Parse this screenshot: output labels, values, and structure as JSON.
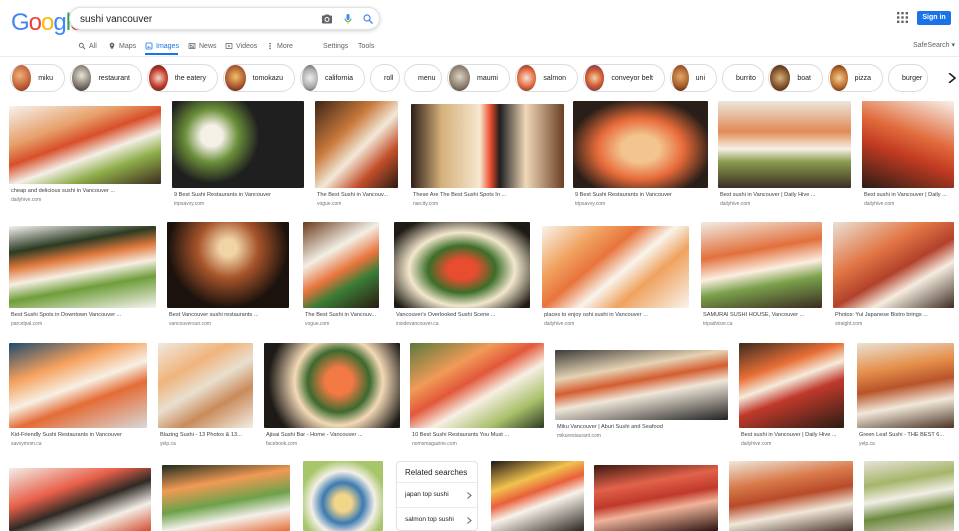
{
  "logo": "Google",
  "colors": {
    "accent": "#1a73e8",
    "g_blue": "#4285f4",
    "g_red": "#ea4335",
    "g_yellow": "#fbbc05",
    "g_green": "#34a853"
  },
  "search": {
    "query": "sushi vancouver",
    "icons": [
      "camera-icon",
      "microphone-icon",
      "search-icon"
    ]
  },
  "header": {
    "apps_icon": "apps-grid-icon",
    "signin_label": "Sign in"
  },
  "tabs": [
    {
      "label": "All",
      "icon": "search-icon",
      "active": false
    },
    {
      "label": "Maps",
      "icon": "map-pin-icon",
      "active": false
    },
    {
      "label": "Images",
      "icon": "image-icon",
      "active": true
    },
    {
      "label": "News",
      "icon": "news-icon",
      "active": false
    },
    {
      "label": "Videos",
      "icon": "play-icon",
      "active": false
    },
    {
      "label": "More",
      "icon": "more-vert-icon",
      "active": false
    }
  ],
  "tools": {
    "settings": "Settings",
    "tools": "Tools",
    "safesearch": "SafeSearch ▾"
  },
  "chips": [
    {
      "label": "miku",
      "thumb": true
    },
    {
      "label": "restaurant",
      "thumb": true
    },
    {
      "label": "the eatery",
      "thumb": true
    },
    {
      "label": "tomokazu",
      "thumb": true
    },
    {
      "label": "california",
      "thumb": true
    },
    {
      "label": "roll",
      "thumb": false
    },
    {
      "label": "menu",
      "thumb": false
    },
    {
      "label": "maumi",
      "thumb": true
    },
    {
      "label": "salmon",
      "thumb": true
    },
    {
      "label": "conveyor belt",
      "thumb": true
    },
    {
      "label": "uni",
      "thumb": true
    },
    {
      "label": "burrito",
      "thumb": false
    },
    {
      "label": "boat",
      "thumb": true
    },
    {
      "label": "pizza",
      "thumb": true
    },
    {
      "label": "burger",
      "thumb": false
    }
  ],
  "results": [
    {
      "caption": "cheap and delicious sushi in Vancouver ...",
      "domain": "dailyhive.com"
    },
    {
      "caption": "9 Best Sushi Restaurants in Vancouver",
      "domain": "tripsavvy.com"
    },
    {
      "caption": "The Best Sushi in Vancouv...",
      "domain": "vogue.com"
    },
    {
      "caption": "These Are The Best Sushi Spots In ...",
      "domain": "narcity.com"
    },
    {
      "caption": "9 Best Sushi Restaurants in Vancouver",
      "domain": "tripsavvy.com"
    },
    {
      "caption": "Best sushi in Vancouver | Daily Hive ...",
      "domain": "dailyhive.com"
    },
    {
      "caption": "Best sushi in Vancouver | Daily ...",
      "domain": "dailyhive.com"
    },
    {
      "caption": "Best Sushi Spots in Downtown Vancouver ...",
      "domain": "parcelpal.com"
    },
    {
      "caption": "Best Vancouver sushi restaurants ...",
      "domain": "vancouversun.com"
    },
    {
      "caption": "The Best Sushi in Vancouv...",
      "domain": "vogue.com"
    },
    {
      "caption": "Vancouver's Overlooked Sushi Scene ...",
      "domain": "insidevancouver.ca"
    },
    {
      "caption": "places to enjoy oshi sushi in Vancouver ...",
      "domain": "dailyhive.com"
    },
    {
      "caption": "SAMURAI SUSHI HOUSE, Vancouver ...",
      "domain": "tripadvisor.ca"
    },
    {
      "caption": "Photos: Yui Japanese Bistro brings ...",
      "domain": "straight.com"
    },
    {
      "caption": "Kid-Friendly Sushi Restaurants in Vancouver",
      "domain": "savvymom.ca"
    },
    {
      "caption": "Blazing Sushi - 13 Photos & 13...",
      "domain": "yelp.ca"
    },
    {
      "caption": "Ajisai Sushi Bar - Home - Vancouver ...",
      "domain": "facebook.com"
    },
    {
      "caption": "10 Best Sushi Restaurants You Must ...",
      "domain": "nomsmagazine.com"
    },
    {
      "caption": "Miku Vancouver | Aburi Sushi and Seafood",
      "domain": "mikurestaurant.com"
    },
    {
      "caption": "Best sushi in Vancouver | Daily Hive ...",
      "domain": "dailyhive.com"
    },
    {
      "caption": "Green Leaf Sushi - THE BEST 6...",
      "domain": "yelp.ca"
    },
    {
      "caption": "",
      "domain": ""
    },
    {
      "caption": "",
      "domain": ""
    },
    {
      "caption": "",
      "domain": ""
    },
    {
      "caption": "",
      "domain": ""
    },
    {
      "caption": "",
      "domain": ""
    },
    {
      "caption": "",
      "domain": ""
    },
    {
      "caption": "",
      "domain": ""
    }
  ],
  "related": {
    "title": "Related searches",
    "items": [
      "japan top sushi",
      "salmon top sushi"
    ]
  }
}
